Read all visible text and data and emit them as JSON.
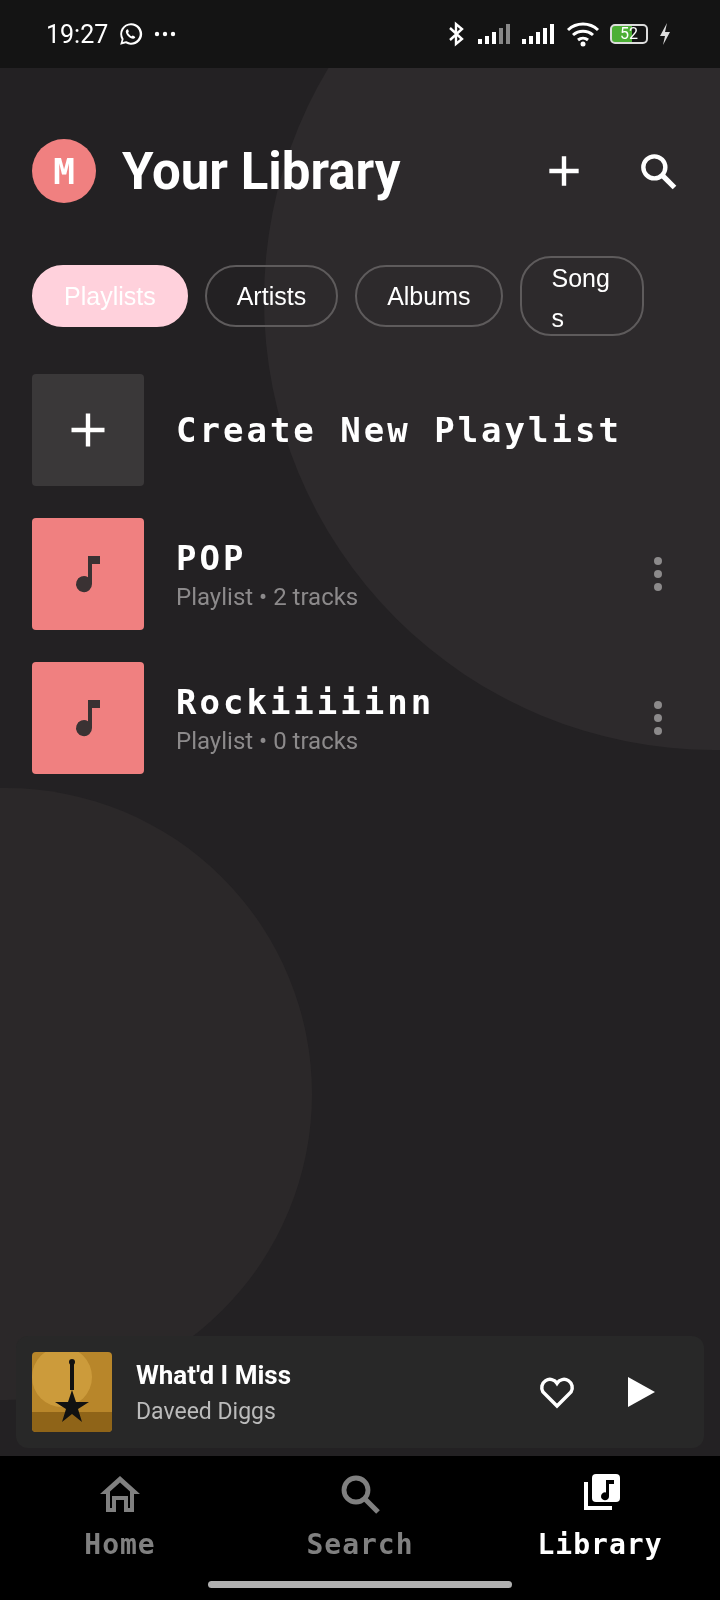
{
  "status_bar": {
    "time": "19:27",
    "battery": "52"
  },
  "header": {
    "avatar": "M",
    "title": "Your Library"
  },
  "filters": [
    {
      "label": "Playlists",
      "selected": true
    },
    {
      "label": "Artists",
      "selected": false
    },
    {
      "label": "Albums",
      "selected": false
    },
    {
      "label": "Songs",
      "selected": false
    }
  ],
  "create": {
    "label": "Create New Playlist"
  },
  "playlists": [
    {
      "name": "POP",
      "subtitle": "Playlist • 2 tracks"
    },
    {
      "name": "Rockiiiiinn",
      "subtitle": "Playlist • 0 tracks"
    }
  ],
  "now_playing": {
    "title": "What'd I Miss",
    "artist": "Daveed Diggs",
    "liked": false
  },
  "nav": [
    {
      "label": "Home",
      "kind": "home",
      "selected": false
    },
    {
      "label": "Search",
      "kind": "search",
      "selected": false
    },
    {
      "label": "Library",
      "kind": "library",
      "selected": true
    }
  ]
}
